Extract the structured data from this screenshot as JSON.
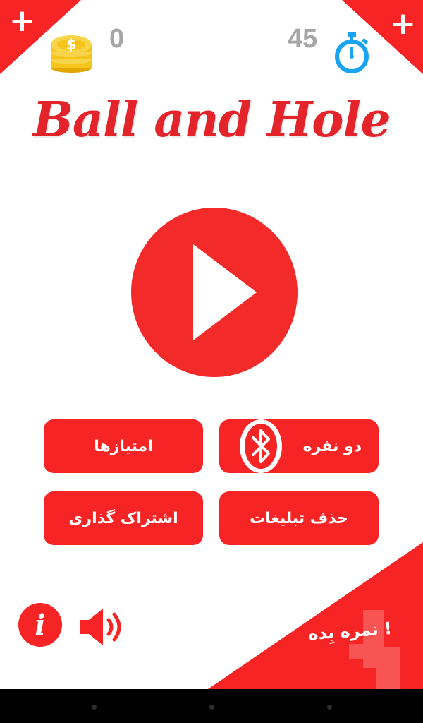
{
  "stats": {
    "coins": "0",
    "time": "45"
  },
  "corner_buttons": {
    "left": "+",
    "right": "+"
  },
  "title": "Ball and Hole",
  "menu": {
    "scores": "امتیازها",
    "two_player": "دو نفره",
    "share": "اشتراک گذاری",
    "remove_ads": "حذف تبلیغات"
  },
  "rate": "نمره بِده !",
  "colors": {
    "primary_red": "#f62424",
    "timer_blue": "#1aa3f0",
    "coin_yellow": "#f6c51c",
    "count_gray": "#a6a6a6"
  },
  "icons": [
    "plus-icon",
    "coin-stack-icon",
    "stopwatch-icon",
    "play-icon",
    "bluetooth-icon",
    "info-icon",
    "speaker-icon",
    "watermark-logo"
  ]
}
